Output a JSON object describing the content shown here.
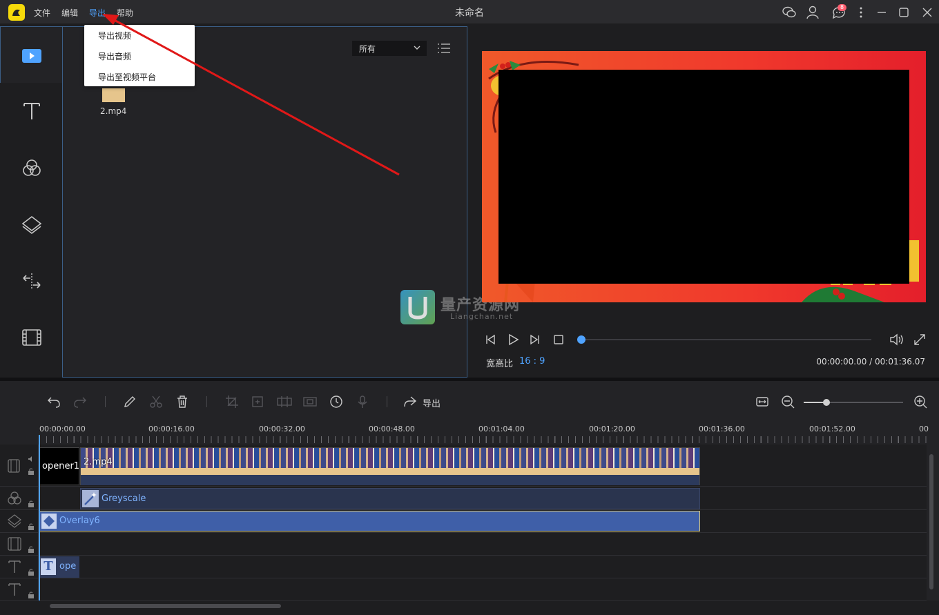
{
  "window": {
    "title": "未命名"
  },
  "menubar": {
    "items": [
      "文件",
      "编辑",
      "导出",
      "帮助"
    ],
    "active": "导出"
  },
  "titlebar": {
    "notification_count": "8",
    "icons": [
      "wechat-icon",
      "user-icon",
      "chat-icon",
      "more-icon",
      "minimize-icon",
      "maximize-icon",
      "close-icon"
    ]
  },
  "export_menu": {
    "items": [
      "导出视频",
      "导出音频",
      "导出至视频平台"
    ]
  },
  "sidebar": {
    "items": [
      "media-icon",
      "text-icon",
      "filter-icon",
      "overlay-icon",
      "transition-icon",
      "film-icon"
    ]
  },
  "media": {
    "filter_selected": "所有",
    "files": [
      {
        "name": "2.mp4"
      }
    ]
  },
  "preview": {
    "aspect_label": "宽高比",
    "aspect_value": "16 : 9",
    "current_time": "00:00:00.00",
    "total_time": "00:01:36.07",
    "progress": 0
  },
  "watermark": {
    "text": "量产资源网",
    "sub": "Liangchan.net"
  },
  "timeline": {
    "export_label": "导出",
    "zoom_level": 0.23,
    "ruler": [
      "00:00:00.00",
      "00:00:16.00",
      "00:00:32.00",
      "00:00:48.00",
      "00:01:04.00",
      "00:01:20.00",
      "00:01:36.00",
      "00:01:52.00",
      "00"
    ],
    "clips": {
      "opener": "opener1",
      "video": "2.mp4",
      "filter": "Greyscale",
      "overlay": "Overlay6",
      "text": "ope"
    }
  },
  "colors": {
    "accent": "#4fa3ff",
    "frame": "#f0382c",
    "logo": "#f5d90a",
    "annotation_arrow": "#e01818"
  }
}
